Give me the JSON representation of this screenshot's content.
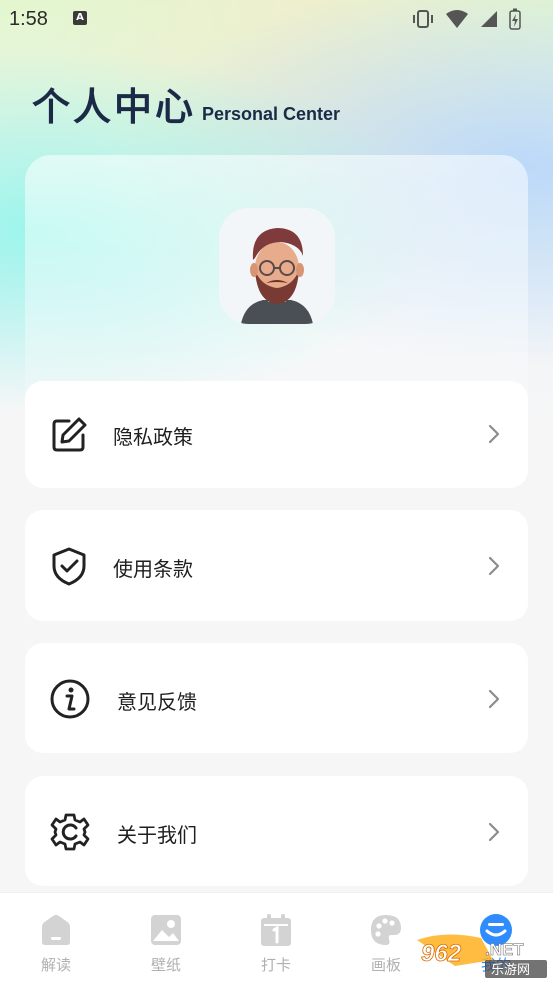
{
  "status_bar": {
    "time": "1:58",
    "notification_icon": "A"
  },
  "header": {
    "title": "个人中心",
    "subtitle": "Personal Center"
  },
  "profile": {
    "avatar_icon": "avatar-icon"
  },
  "menu": {
    "items": [
      {
        "label": "隐私政策",
        "icon": "edit-icon"
      },
      {
        "label": "使用条款",
        "icon": "shield-check-icon"
      },
      {
        "label": "意见反馈",
        "icon": "info-icon"
      },
      {
        "label": "关于我们",
        "icon": "gear-icon"
      }
    ]
  },
  "tabbar": {
    "tabs": [
      {
        "label": "解读",
        "icon": "home-icon"
      },
      {
        "label": "壁纸",
        "icon": "image-icon"
      },
      {
        "label": "打卡",
        "icon": "calendar-icon"
      },
      {
        "label": "画板",
        "icon": "palette-icon"
      },
      {
        "label": "我的",
        "icon": "user-icon",
        "active": true
      }
    ]
  },
  "watermark": {
    "text_top": "962.NET",
    "text_bottom": "乐游网"
  },
  "colors": {
    "title": "#1b2a47",
    "accent": "#2f8cff",
    "tab_inactive": "#b0b0b0"
  }
}
